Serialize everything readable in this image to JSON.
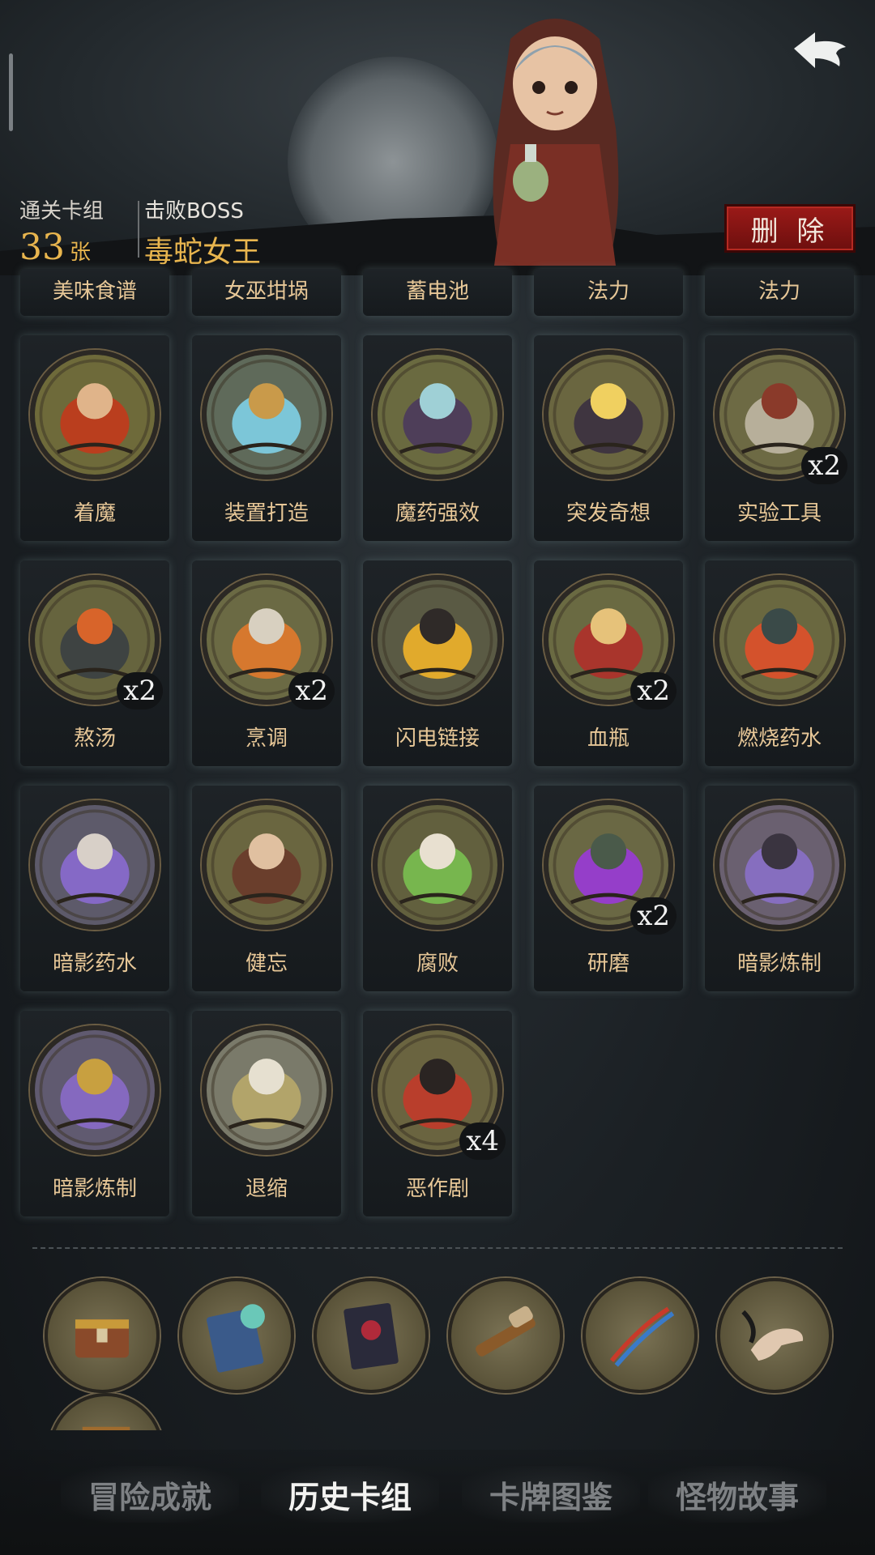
{
  "header": {
    "deck_label": "通关卡组",
    "deck_count": "33",
    "deck_unit": "张",
    "boss_label": "击败BOSS",
    "boss_name": "毒蛇女王",
    "delete_label": "删 除"
  },
  "cards_partial": [
    {
      "name": "美味食谱"
    },
    {
      "name": "女巫坩埚"
    },
    {
      "name": "蓄电池"
    },
    {
      "name": "法力"
    },
    {
      "name": "法力"
    }
  ],
  "cards": [
    {
      "name": "着魔",
      "mult": ""
    },
    {
      "name": "装置打造",
      "mult": ""
    },
    {
      "name": "魔药强效",
      "mult": ""
    },
    {
      "name": "突发奇想",
      "mult": ""
    },
    {
      "name": "实验工具",
      "mult": "x2"
    },
    {
      "name": "熬汤",
      "mult": "x2"
    },
    {
      "name": "烹调",
      "mult": "x2"
    },
    {
      "name": "闪电链接",
      "mult": ""
    },
    {
      "name": "血瓶",
      "mult": "x2"
    },
    {
      "name": "燃烧药水",
      "mult": ""
    },
    {
      "name": "暗影药水",
      "mult": ""
    },
    {
      "name": "健忘",
      "mult": ""
    },
    {
      "name": "腐败",
      "mult": ""
    },
    {
      "name": "研磨",
      "mult": "x2"
    },
    {
      "name": "暗影炼制",
      "mult": ""
    },
    {
      "name": "暗影炼制",
      "mult": ""
    },
    {
      "name": "退缩",
      "mult": ""
    },
    {
      "name": "恶作剧",
      "mult": "x4"
    }
  ],
  "relics": [
    "treasure-chest-icon",
    "spellbook-icon",
    "tome-icon",
    "spyglass-icon",
    "dna-helix-icon",
    "open-hand-icon"
  ],
  "tabs": [
    {
      "label": "冒险成就",
      "active": false
    },
    {
      "label": "历史卡组",
      "active": true
    },
    {
      "label": "卡牌图鉴",
      "active": false
    },
    {
      "label": "怪物故事",
      "active": false
    }
  ]
}
